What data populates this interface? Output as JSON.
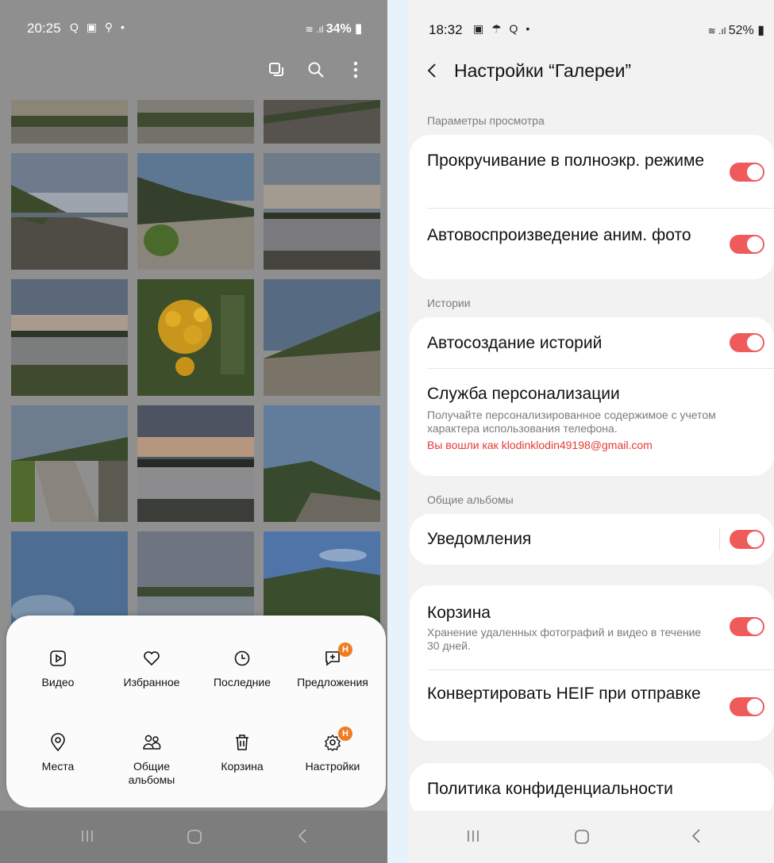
{
  "left": {
    "status": {
      "time": "20:25",
      "icons": "Q ▣ ⚲ •",
      "right": "34%"
    },
    "toolbar_icons": [
      "select-icon",
      "search-icon",
      "more-icon"
    ],
    "menu": [
      {
        "label": "Видео",
        "icon": "video-icon"
      },
      {
        "label": "Избранное",
        "icon": "heart-icon"
      },
      {
        "label": "Последние",
        "icon": "clock-icon"
      },
      {
        "label": "Предложения",
        "icon": "suggestions-icon",
        "badge": "Н"
      },
      {
        "label": "Места",
        "icon": "location-icon"
      },
      {
        "label": "Общие альбомы",
        "icon": "shared-albums-icon"
      },
      {
        "label": "Корзина",
        "icon": "trash-icon"
      },
      {
        "label": "Настройки",
        "icon": "gear-icon",
        "badge": "Н"
      }
    ]
  },
  "right": {
    "status": {
      "time": "18:32",
      "icons": "▣ ☂ Q •",
      "right": "52%"
    },
    "title": "Настройки “Галереи”",
    "sections": {
      "view": "Параметры просмотра",
      "stories": "Истории",
      "shared": "Общие альбомы"
    },
    "items": {
      "fullscreen": "Прокручивание в полноэкр. режиме",
      "autoplay": "Автовоспроизведение аним. фото",
      "autostories": "Автосоздание историй",
      "personalization": "Служба персонализации",
      "personalization_sub": "Получайте персонализированное содержимое с учетом характера использования телефона.",
      "account": "Вы вошли как klodinklodin49198@gmail.com",
      "notifications": "Уведомления",
      "trash": "Корзина",
      "trash_sub": "Хранение удаленных фотографий и видео в течение 30 дней.",
      "heif": "Конвертировать HEIF при отправке",
      "privacy": "Политика конфиденциальности"
    },
    "toggles": {
      "fullscreen": true,
      "autoplay": true,
      "autostories": true,
      "notifications": true,
      "trash": true,
      "heif": true
    },
    "accent": "#ef5b5b"
  }
}
